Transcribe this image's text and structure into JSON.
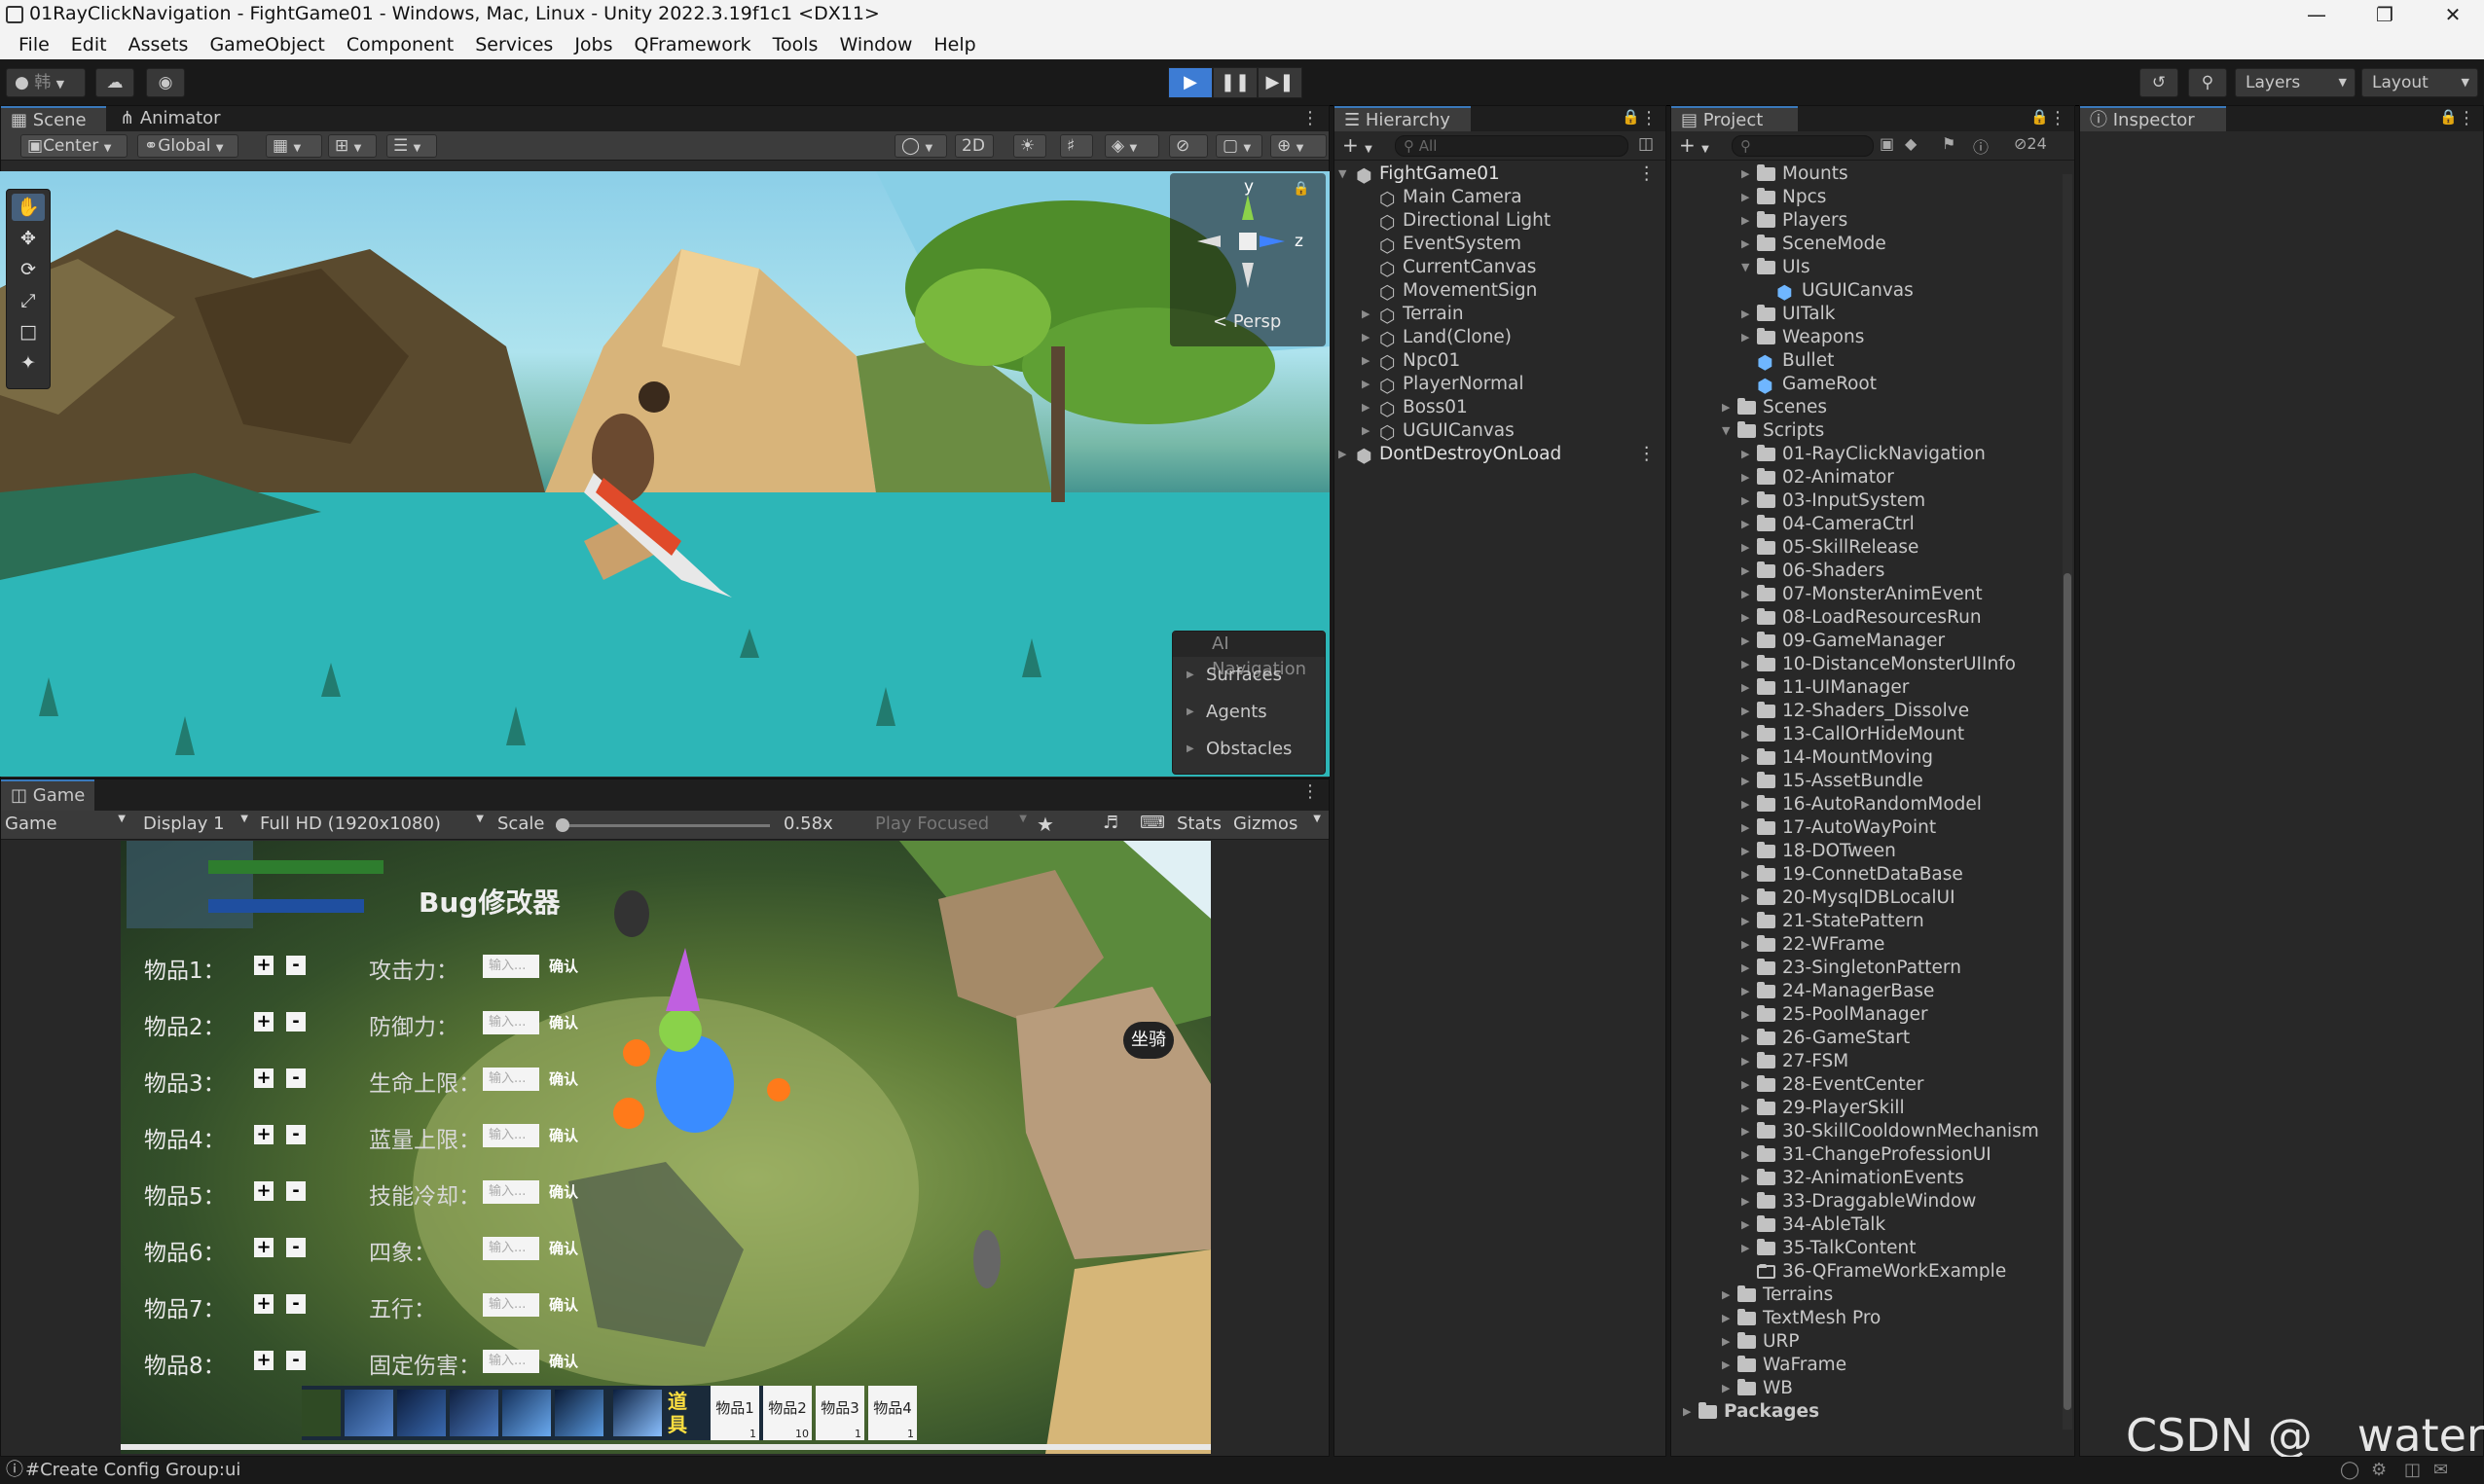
{
  "window": {
    "title": "01RayClickNavigation - FightGame01 - Windows, Mac, Linux - Unity 2022.3.19f1c1 <DX11>"
  },
  "menu": [
    "File",
    "Edit",
    "Assets",
    "GameObject",
    "Component",
    "Services",
    "Jobs",
    "QFramework",
    "Tools",
    "Window",
    "Help"
  ],
  "toolbar": {
    "account": "韩",
    "layers": "Layers",
    "layout": "Layout"
  },
  "scene": {
    "tabs": [
      "Scene",
      "Animator"
    ],
    "pivot": "Center",
    "space": "Global",
    "mode2d": "2D",
    "persp": "Persp",
    "axis_y": "y",
    "axis_z": "z",
    "ai_nav": {
      "title": "AI Navigation",
      "items": [
        "Surfaces",
        "Agents",
        "Obstacles"
      ]
    }
  },
  "game": {
    "tab": "Game",
    "view": "Game",
    "display": "Display 1",
    "resolution": "Full HD (1920x1080)",
    "scale_label": "Scale",
    "scale_value": "0.58x",
    "play_focused": "Play Focused",
    "stats": "Stats",
    "gizmos": "Gizmos",
    "bug_title": "Bug修改器",
    "rows": [
      {
        "item": "物品1：",
        "attr": "攻击力："
      },
      {
        "item": "物品2：",
        "attr": "防御力："
      },
      {
        "item": "物品3：",
        "attr": "生命上限："
      },
      {
        "item": "物品4：",
        "attr": "蓝量上限："
      },
      {
        "item": "物品5：",
        "attr": "技能冷却："
      },
      {
        "item": "物品6：",
        "attr": "四象："
      },
      {
        "item": "物品7：",
        "attr": "五行："
      },
      {
        "item": "物品8：",
        "attr": "固定伤害："
      }
    ],
    "input_placeholder": "输入...",
    "confirm": "确认",
    "plus": "+",
    "minus": "-",
    "mount": "坐骑",
    "side_label": "道具",
    "slots": [
      {
        "name": "物品1",
        "count": "1"
      },
      {
        "name": "物品2",
        "count": "10"
      },
      {
        "name": "物品3",
        "count": "1"
      },
      {
        "name": "物品4",
        "count": "1"
      }
    ]
  },
  "hierarchy": {
    "tab": "Hierarchy",
    "search_placeholder": "All",
    "items": [
      {
        "label": "FightGame01",
        "depth": 0,
        "scene": true,
        "expanded": true
      },
      {
        "label": "Main Camera",
        "depth": 1
      },
      {
        "label": "Directional Light",
        "depth": 1
      },
      {
        "label": "EventSystem",
        "depth": 1
      },
      {
        "label": "CurrentCanvas",
        "depth": 1
      },
      {
        "label": "MovementSign",
        "depth": 1
      },
      {
        "label": "Terrain",
        "depth": 1,
        "arrow": true
      },
      {
        "label": "Land(Clone)",
        "depth": 1,
        "arrow": true
      },
      {
        "label": "Npc01",
        "depth": 1,
        "arrow": true
      },
      {
        "label": "PlayerNormal",
        "depth": 1,
        "arrow": true
      },
      {
        "label": "Boss01",
        "depth": 1,
        "arrow": true
      },
      {
        "label": "UGUICanvas",
        "depth": 1,
        "arrow": true
      },
      {
        "label": "DontDestroyOnLoad",
        "depth": 0,
        "scene": true,
        "arrow": true
      }
    ]
  },
  "project": {
    "tab": "Project",
    "hidden_count": "24",
    "items": [
      {
        "label": "Mounts",
        "depth": 3,
        "type": "folder"
      },
      {
        "label": "Npcs",
        "depth": 3,
        "type": "folder"
      },
      {
        "label": "Players",
        "depth": 3,
        "type": "folder"
      },
      {
        "label": "SceneMode",
        "depth": 3,
        "type": "folder"
      },
      {
        "label": "UIs",
        "depth": 3,
        "type": "folder",
        "open": true
      },
      {
        "label": "UGUICanvas",
        "depth": 4,
        "type": "prefab"
      },
      {
        "label": "UITalk",
        "depth": 3,
        "type": "folder"
      },
      {
        "label": "Weapons",
        "depth": 3,
        "type": "folder"
      },
      {
        "label": "Bullet",
        "depth": 3,
        "type": "prefab"
      },
      {
        "label": "GameRoot",
        "depth": 3,
        "type": "prefab"
      },
      {
        "label": "Scenes",
        "depth": 2,
        "type": "folder"
      },
      {
        "label": "Scripts",
        "depth": 2,
        "type": "folder",
        "open": true
      },
      {
        "label": "01-RayClickNavigation",
        "depth": 3,
        "type": "folder"
      },
      {
        "label": "02-Animator",
        "depth": 3,
        "type": "folder"
      },
      {
        "label": "03-InputSystem",
        "depth": 3,
        "type": "folder"
      },
      {
        "label": "04-CameraCtrl",
        "depth": 3,
        "type": "folder"
      },
      {
        "label": "05-SkillRelease",
        "depth": 3,
        "type": "folder"
      },
      {
        "label": "06-Shaders",
        "depth": 3,
        "type": "folder"
      },
      {
        "label": "07-MonsterAnimEvent",
        "depth": 3,
        "type": "folder"
      },
      {
        "label": "08-LoadResourcesRun",
        "depth": 3,
        "type": "folder"
      },
      {
        "label": "09-GameManager",
        "depth": 3,
        "type": "folder"
      },
      {
        "label": "10-DistanceMonsterUIInfo",
        "depth": 3,
        "type": "folder"
      },
      {
        "label": "11-UIManager",
        "depth": 3,
        "type": "folder"
      },
      {
        "label": "12-Shaders_Dissolve",
        "depth": 3,
        "type": "folder"
      },
      {
        "label": "13-CallOrHideMount",
        "depth": 3,
        "type": "folder"
      },
      {
        "label": "14-MountMoving",
        "depth": 3,
        "type": "folder"
      },
      {
        "label": "15-AssetBundle",
        "depth": 3,
        "type": "folder"
      },
      {
        "label": "16-AutoRandomModel",
        "depth": 3,
        "type": "folder"
      },
      {
        "label": "17-AutoWayPoint",
        "depth": 3,
        "type": "folder"
      },
      {
        "label": "18-DOTween",
        "depth": 3,
        "type": "folder"
      },
      {
        "label": "19-ConnetDataBase",
        "depth": 3,
        "type": "folder"
      },
      {
        "label": "20-MysqlDBLocalUI",
        "depth": 3,
        "type": "folder"
      },
      {
        "label": "21-StatePattern",
        "depth": 3,
        "type": "folder"
      },
      {
        "label": "22-WFrame",
        "depth": 3,
        "type": "folder"
      },
      {
        "label": "23-SingletonPattern",
        "depth": 3,
        "type": "folder"
      },
      {
        "label": "24-ManagerBase",
        "depth": 3,
        "type": "folder"
      },
      {
        "label": "25-PoolManager",
        "depth": 3,
        "type": "folder"
      },
      {
        "label": "26-GameStart",
        "depth": 3,
        "type": "folder"
      },
      {
        "label": "27-FSM",
        "depth": 3,
        "type": "folder"
      },
      {
        "label": "28-EventCenter",
        "depth": 3,
        "type": "folder"
      },
      {
        "label": "29-PlayerSkill",
        "depth": 3,
        "type": "folder"
      },
      {
        "label": "30-SkillCooldownMechanism",
        "depth": 3,
        "type": "folder"
      },
      {
        "label": "31-ChangeProfessionUI",
        "depth": 3,
        "type": "folder"
      },
      {
        "label": "32-AnimationEvents",
        "depth": 3,
        "type": "folder"
      },
      {
        "label": "33-DraggableWindow",
        "depth": 3,
        "type": "folder"
      },
      {
        "label": "34-AbleTalk",
        "depth": 3,
        "type": "folder"
      },
      {
        "label": "35-TalkContent",
        "depth": 3,
        "type": "folder"
      },
      {
        "label": "36-QFrameWorkExample",
        "depth": 3,
        "type": "empty-folder"
      },
      {
        "label": "Terrains",
        "depth": 2,
        "type": "folder"
      },
      {
        "label": "TextMesh Pro",
        "depth": 2,
        "type": "folder"
      },
      {
        "label": "URP",
        "depth": 2,
        "type": "folder"
      },
      {
        "label": "WaFrame",
        "depth": 2,
        "type": "folder"
      },
      {
        "label": "WB",
        "depth": 2,
        "type": "folder"
      },
      {
        "label": "Packages",
        "depth": 0,
        "type": "folder",
        "bold": true
      }
    ]
  },
  "inspector": {
    "tab": "Inspector"
  },
  "status": {
    "message": "#Create Config Group:ui"
  },
  "watermark": "CSDN @__water",
  "colors": {
    "accent": "#3d7cd4",
    "panel": "#282828",
    "selected_tab": "#3c3c3c"
  }
}
